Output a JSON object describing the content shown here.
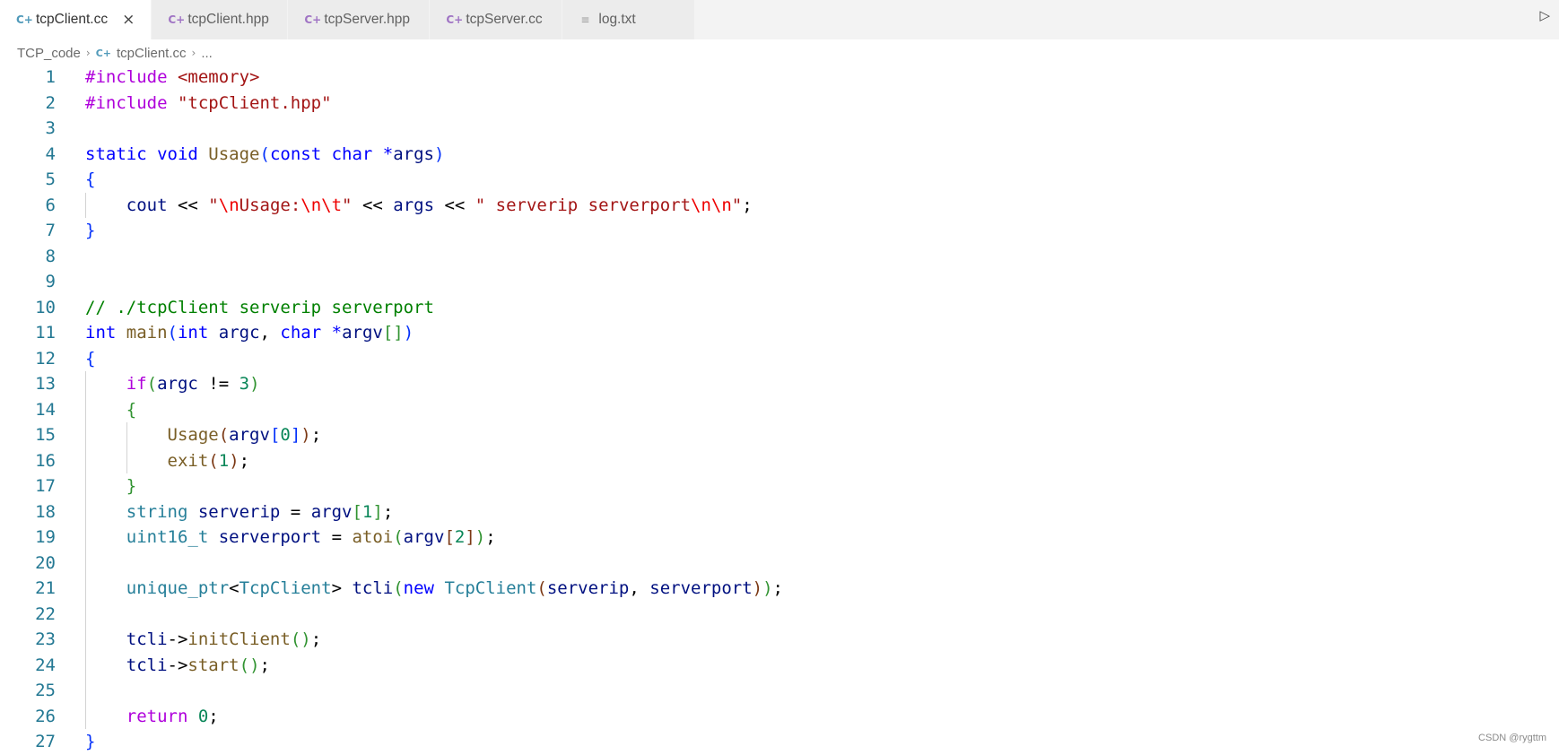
{
  "tabs": [
    {
      "label": "tcpClient.cc",
      "icon": "cpp-file-icon",
      "active": true
    },
    {
      "label": "tcpClient.hpp",
      "icon": "cpp-file-icon",
      "active": false
    },
    {
      "label": "tcpServer.hpp",
      "icon": "cpp-file-icon",
      "active": false
    },
    {
      "label": "tcpServer.cc",
      "icon": "cpp-file-icon",
      "active": false
    },
    {
      "label": "log.txt",
      "icon": "text-file-icon",
      "active": false
    }
  ],
  "breadcrumb": {
    "folder": "TCP_code",
    "file": "tcpClient.cc",
    "more": "..."
  },
  "code_lines": [
    [
      [
        "pre",
        "#include "
      ],
      [
        "str",
        "<memory>"
      ]
    ],
    [
      [
        "pre",
        "#include "
      ],
      [
        "str",
        "\"tcpClient.hpp\""
      ]
    ],
    [],
    [
      [
        "kw",
        "static "
      ],
      [
        "kw",
        "void "
      ],
      [
        "fn",
        "Usage"
      ],
      [
        "b1",
        "("
      ],
      [
        "kw",
        "const "
      ],
      [
        "kw",
        "char "
      ],
      [
        "kw",
        "*"
      ],
      [
        "var",
        "args"
      ],
      [
        "b1",
        ")"
      ]
    ],
    [
      [
        "b1",
        "{"
      ]
    ],
    [
      [
        "plain",
        "    "
      ],
      [
        "var",
        "cout "
      ],
      [
        "plain",
        "<< "
      ],
      [
        "str",
        "\""
      ],
      [
        "esc",
        "\\n"
      ],
      [
        "str",
        "Usage:"
      ],
      [
        "esc",
        "\\n\\t"
      ],
      [
        "str",
        "\" "
      ],
      [
        "plain",
        "<< "
      ],
      [
        "var",
        "args "
      ],
      [
        "plain",
        "<< "
      ],
      [
        "str",
        "\" serverip serverport"
      ],
      [
        "esc",
        "\\n\\n"
      ],
      [
        "str",
        "\""
      ],
      [
        "plain",
        ";"
      ]
    ],
    [
      [
        "b1",
        "}"
      ]
    ],
    [],
    [],
    [
      [
        "cmt",
        "// ./tcpClient serverip serverport"
      ]
    ],
    [
      [
        "kw",
        "int "
      ],
      [
        "fn",
        "main"
      ],
      [
        "b1",
        "("
      ],
      [
        "kw",
        "int "
      ],
      [
        "var",
        "argc"
      ],
      [
        "plain",
        ", "
      ],
      [
        "kw",
        "char "
      ],
      [
        "kw",
        "*"
      ],
      [
        "var",
        "argv"
      ],
      [
        "b2",
        "[]"
      ],
      [
        "b1",
        ")"
      ]
    ],
    [
      [
        "b1",
        "{"
      ]
    ],
    [
      [
        "plain",
        "    "
      ],
      [
        "ctl",
        "if"
      ],
      [
        "b2",
        "("
      ],
      [
        "var",
        "argc "
      ],
      [
        "plain",
        "!= "
      ],
      [
        "num",
        "3"
      ],
      [
        "b2",
        ")"
      ]
    ],
    [
      [
        "plain",
        "    "
      ],
      [
        "b2",
        "{"
      ]
    ],
    [
      [
        "plain",
        "        "
      ],
      [
        "fn",
        "Usage"
      ],
      [
        "b3",
        "("
      ],
      [
        "var",
        "argv"
      ],
      [
        "b1",
        "["
      ],
      [
        "num",
        "0"
      ],
      [
        "b1",
        "]"
      ],
      [
        "b3",
        ")"
      ],
      [
        "plain",
        ";"
      ]
    ],
    [
      [
        "plain",
        "        "
      ],
      [
        "fn",
        "exit"
      ],
      [
        "b3",
        "("
      ],
      [
        "num",
        "1"
      ],
      [
        "b3",
        ")"
      ],
      [
        "plain",
        ";"
      ]
    ],
    [
      [
        "plain",
        "    "
      ],
      [
        "b2",
        "}"
      ]
    ],
    [
      [
        "plain",
        "    "
      ],
      [
        "type",
        "string "
      ],
      [
        "var",
        "serverip "
      ],
      [
        "plain",
        "= "
      ],
      [
        "var",
        "argv"
      ],
      [
        "b2",
        "["
      ],
      [
        "num",
        "1"
      ],
      [
        "b2",
        "]"
      ],
      [
        "plain",
        ";"
      ]
    ],
    [
      [
        "plain",
        "    "
      ],
      [
        "type",
        "uint16_t "
      ],
      [
        "var",
        "serverport "
      ],
      [
        "plain",
        "= "
      ],
      [
        "fn",
        "atoi"
      ],
      [
        "b2",
        "("
      ],
      [
        "var",
        "argv"
      ],
      [
        "b3",
        "["
      ],
      [
        "num",
        "2"
      ],
      [
        "b3",
        "]"
      ],
      [
        "b2",
        ")"
      ],
      [
        "plain",
        ";"
      ]
    ],
    [],
    [
      [
        "plain",
        "    "
      ],
      [
        "type",
        "unique_ptr"
      ],
      [
        "plain",
        "<"
      ],
      [
        "type",
        "TcpClient"
      ],
      [
        "plain",
        "> "
      ],
      [
        "var",
        "tcli"
      ],
      [
        "b2",
        "("
      ],
      [
        "kw",
        "new "
      ],
      [
        "type",
        "TcpClient"
      ],
      [
        "b3",
        "("
      ],
      [
        "var",
        "serverip"
      ],
      [
        "plain",
        ", "
      ],
      [
        "var",
        "serverport"
      ],
      [
        "b3",
        ")"
      ],
      [
        "b2",
        ")"
      ],
      [
        "plain",
        ";"
      ]
    ],
    [],
    [
      [
        "plain",
        "    "
      ],
      [
        "var",
        "tcli"
      ],
      [
        "plain",
        "->"
      ],
      [
        "fn",
        "initClient"
      ],
      [
        "b2",
        "()"
      ],
      [
        "plain",
        ";"
      ]
    ],
    [
      [
        "plain",
        "    "
      ],
      [
        "var",
        "tcli"
      ],
      [
        "plain",
        "->"
      ],
      [
        "fn",
        "start"
      ],
      [
        "b2",
        "()"
      ],
      [
        "plain",
        ";"
      ]
    ],
    [],
    [
      [
        "plain",
        "    "
      ],
      [
        "ctl",
        "return "
      ],
      [
        "num",
        "0"
      ],
      [
        "plain",
        ";"
      ]
    ],
    [
      [
        "b1",
        "}"
      ]
    ]
  ],
  "line_numbers": [
    "1",
    "2",
    "3",
    "4",
    "5",
    "6",
    "7",
    "8",
    "9",
    "10",
    "11",
    "12",
    "13",
    "14",
    "15",
    "16",
    "17",
    "18",
    "19",
    "20",
    "21",
    "22",
    "23",
    "24",
    "25",
    "26",
    "27"
  ],
  "watermark": "CSDN @rygttm"
}
